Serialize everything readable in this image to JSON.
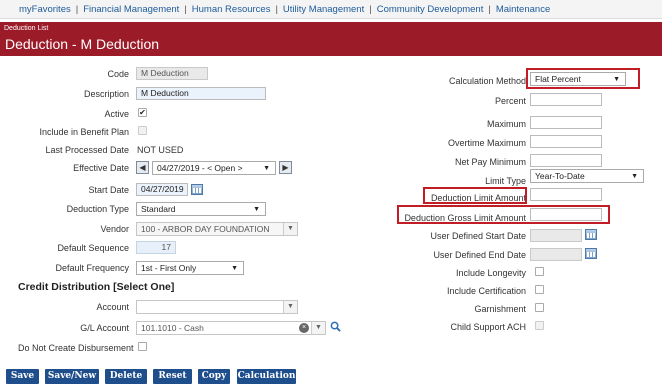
{
  "nav": {
    "items": [
      "myFavorites",
      "Financial Management",
      "Human Resources",
      "Utility Management",
      "Community Development",
      "Maintenance"
    ],
    "separator": "|"
  },
  "header": {
    "breadcrumb": "Deduction List",
    "title": "Deduction - M Deduction"
  },
  "form": {
    "code_label": "Code",
    "code_value": "M Deduction",
    "description_label": "Description",
    "description_value": "M Deduction",
    "active_label": "Active",
    "active_checked": true,
    "check_mark": "✔",
    "include_benefit_label": "Include in Benefit Plan",
    "last_processed_label": "Last Processed Date",
    "last_processed_value": "NOT USED",
    "effective_date_label": "Effective Date",
    "effective_date_value": "04/27/2019 - < Open >",
    "start_date_label": "Start Date",
    "start_date_value": "04/27/2019",
    "deduction_type_label": "Deduction Type",
    "deduction_type_value": "Standard",
    "vendor_label": "Vendor",
    "vendor_value": "100 - ARBOR DAY FOUNDATION",
    "default_sequence_label": "Default Sequence",
    "default_sequence_value": "17",
    "default_frequency_label": "Default Frequency",
    "default_frequency_value": "1st - First Only"
  },
  "credit": {
    "section_title": "Credit Distribution [Select One]",
    "account_label": "Account",
    "account_value": "",
    "gl_account_label": "G/L Account",
    "gl_account_value": "101.1010 - Cash",
    "no_disbursement_label": "Do Not Create Disbursement"
  },
  "right": {
    "calc_method_label": "Calculation Method",
    "calc_method_value": "Flat Percent",
    "percent_label": "Percent",
    "maximum_label": "Maximum",
    "overtime_max_label": "Overtime Maximum",
    "net_pay_min_label": "Net Pay Minimum",
    "limit_type_label": "Limit Type",
    "limit_type_value": "Year-To-Date",
    "ded_limit_label": "Deduction Limit Amount",
    "ded_gross_limit_label": "Deduction Gross Limit Amount",
    "user_start_label": "User Defined Start Date",
    "user_end_label": "User Defined End Date",
    "include_longevity_label": "Include Longevity",
    "include_cert_label": "Include Certification",
    "garnishment_label": "Garnishment",
    "child_support_label": "Child Support ACH"
  },
  "buttons": {
    "save": "Save",
    "save_new": "Save/New",
    "delete": "Delete",
    "reset": "Reset",
    "copy": "Copy",
    "calculation": "Calculation"
  },
  "icons": {
    "calendar": "calendar-icon",
    "search": "search-icon",
    "clear": "clear-icon",
    "chevron_down": "chevron-down-icon",
    "prev": "chevron-left-icon",
    "next": "chevron-right-icon"
  },
  "colors": {
    "banner": "#9c1b29",
    "link": "#1e5b9b",
    "button": "#1f4e8c",
    "highlight": "#c11d25"
  }
}
